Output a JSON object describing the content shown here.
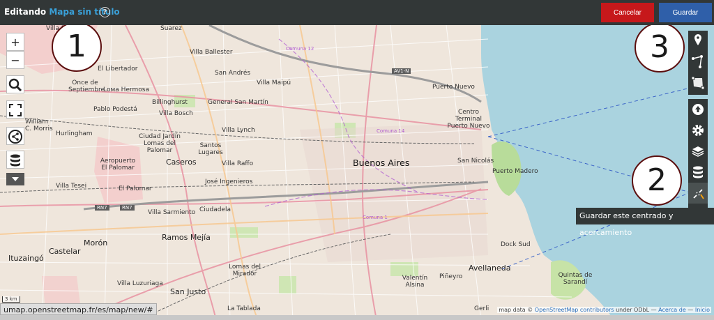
{
  "header": {
    "editing_label": "Editando",
    "map_title": "Mapa sin título",
    "help_label": "?",
    "cancel_label": "Cancelar",
    "save_label": "Guardar"
  },
  "left_controls": {
    "zoom_in": "+",
    "zoom_out": "−"
  },
  "right_controls": {
    "tooltip": "Guardar este centrado y acercamiento"
  },
  "callouts": [
    "1",
    "2",
    "3"
  ],
  "map_labels": {
    "places": [
      "Suarez",
      "Villa Ballester",
      "San Andrés",
      "Villa Maipú",
      "General San Martín",
      "Lома Hermosa",
      "El Libertador",
      "Once de Septiembre",
      "Pablo Podestá",
      "Villa Bosch",
      "Billinghurst",
      "Hurlingham",
      "Ciudad Jardín Lomas del Palomar",
      "Caseros",
      "Santos Lugares",
      "Villa Lynch",
      "Villa Raffo",
      "Aeropuerto El Palomar",
      "El Palomar",
      "José Ingenieros",
      "Villa Tesei",
      "Villa Sarmiento",
      "Ciudadela",
      "Ramos Mejía",
      "Morón",
      "Castelar",
      "Ituzaingó",
      "Lomas del Mirador",
      "San Justo",
      "Villa Luzuriaga",
      "La Tablada",
      "Buenos Aires",
      "Puerto Nuevo",
      "Centro Terminal Puerto Nuevo",
      "Puerto Madero",
      "San Nicolás",
      "Dock Sud",
      "Avellaneda",
      "Valentín Alsina",
      "Piñeyro",
      "Gerli",
      "Quintas de Sarandí",
      "Villa Martelli",
      "William C. Morris"
    ],
    "road_shields": [
      "AV1-N",
      "RN7",
      "RN7"
    ],
    "comuna": [
      "Comuna 12",
      "Comuna 14",
      "Comuna 1"
    ]
  },
  "footer": {
    "url": "umap.openstreetmap.fr/es/map/new/#",
    "attribution_prefix": "map data © ",
    "attribution_link": "OpenStreetMap contributors",
    "attribution_mid": " under ODbL — ",
    "about": "Acerca de",
    "separator": " — ",
    "home": "Inicio",
    "scale": "3 km"
  },
  "colors": {
    "topbar": "#323737",
    "map_title": "#3aa0d8",
    "cancel": "#c6181b",
    "save": "#2f5fa9",
    "water": "#aad3df",
    "callout_border": "#5b0e0e"
  }
}
